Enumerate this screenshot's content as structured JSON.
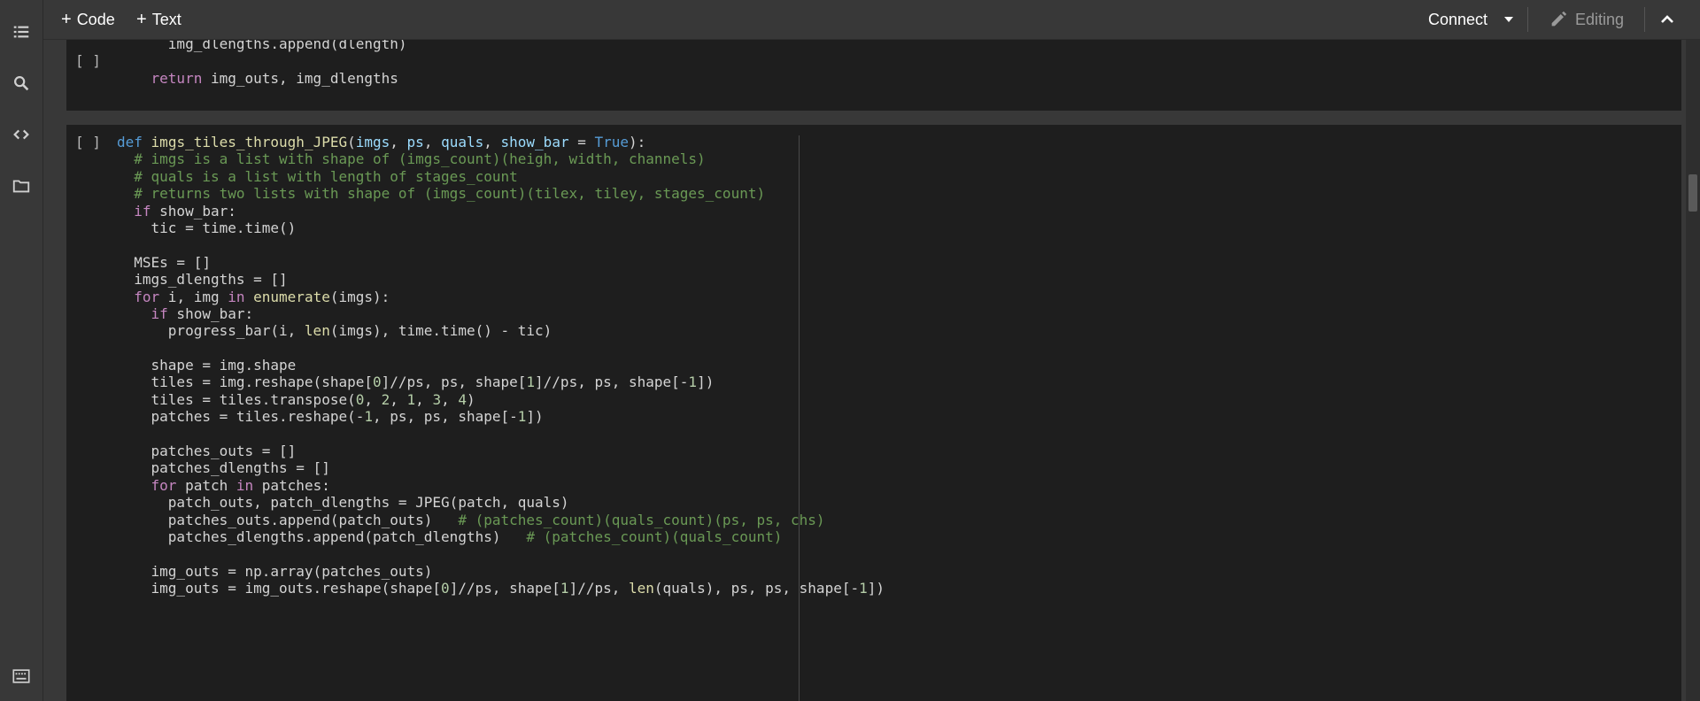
{
  "toolbar": {
    "code_label": "Code",
    "text_label": "Text",
    "connect_label": "Connect",
    "editing_label": "Editing"
  },
  "icons": {
    "toc": "list-icon",
    "search": "search-icon",
    "code_snippets": "code-icon",
    "files": "folder-icon",
    "terminal": "terminal-icon",
    "edit": "pencil-icon",
    "collapse": "chevron-up-icon",
    "dropdown": "caret-down-icon"
  },
  "colors": {
    "background": "#383838",
    "cell_background": "#1e1e1e",
    "keyword": "#c586c0",
    "def_keyword": "#569cd6",
    "function": "#dcdcaa",
    "comment": "#6a9955",
    "number": "#b5cea8"
  },
  "cells": {
    "cell1": {
      "indicator": "[ ]",
      "lines": [
        "      img_dlengths.append(dlength)",
        "",
        "    return img_outs, img_dlengths"
      ]
    },
    "cell2": {
      "indicator": "[ ]",
      "lines": [
        "def imgs_tiles_through_JPEG(imgs, ps, quals, show_bar = True):",
        "  # imgs is a list with shape of (imgs_count)(heigh, width, channels)",
        "  # quals is a list with length of stages_count",
        "  # returns two lists with shape of (imgs_count)(tilex, tiley, stages_count)",
        "  if show_bar:",
        "    tic = time.time()",
        "",
        "  MSEs = []",
        "  imgs_dlengths = []",
        "  for i, img in enumerate(imgs):",
        "    if show_bar:",
        "      progress_bar(i, len(imgs), time.time() - tic)",
        "",
        "    shape = img.shape",
        "    tiles = img.reshape(shape[0]//ps, ps, shape[1]//ps, ps, shape[-1])",
        "    tiles = tiles.transpose(0, 2, 1, 3, 4)",
        "    patches = tiles.reshape(-1, ps, ps, shape[-1])",
        "",
        "    patches_outs = []",
        "    patches_dlengths = []",
        "    for patch in patches:",
        "      patch_outs, patch_dlengths = JPEG(patch, quals)",
        "      patches_outs.append(patch_outs)   # (patches_count)(quals_count)(ps, ps, chs)",
        "      patches_dlengths.append(patch_dlengths)   # (patches_count)(quals_count)",
        "",
        "    img_outs = np.array(patches_outs)",
        "    img_outs = img_outs.reshape(shape[0]//ps, shape[1]//ps, len(quals), ps, ps, shape[-1])"
      ]
    }
  }
}
